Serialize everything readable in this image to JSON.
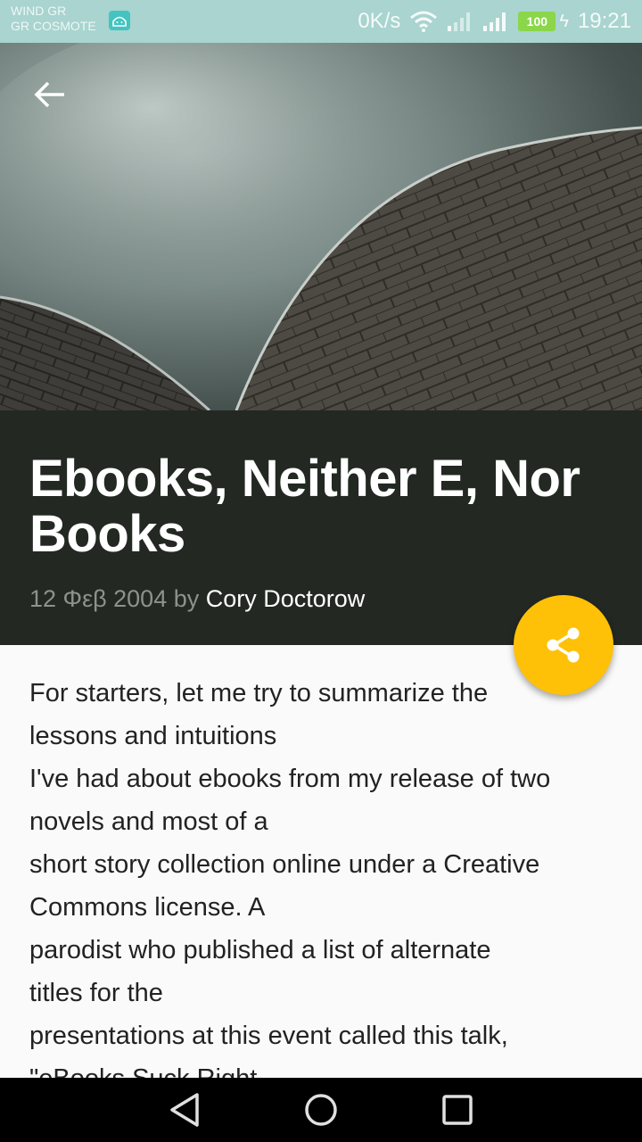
{
  "status_bar": {
    "carrier_line1": "WIND GR",
    "carrier_line2": "GR COSMOTE",
    "net_speed": "0K/s",
    "battery": "100",
    "time": "19:21"
  },
  "article": {
    "title": "Ebooks, Neither E, Nor Books",
    "date": "12 Φεβ 2004",
    "by": " by ",
    "author": "Cory Doctorow",
    "body_lines": [
      "For starters, let me try to summarize the",
      "lessons and intuitions",
      "I've had about ebooks from my release of two",
      "novels and most of a",
      "short story collection online under a Creative",
      "Commons license. A",
      "parodist who published a list of alternate",
      "titles for the",
      "presentations at this event called this talk,",
      "\"eBooks Suck Right"
    ]
  },
  "colors": {
    "status_bar": "#a9d4cf",
    "title_band": "#232823",
    "fab": "#ffc107",
    "background": "#fafafa"
  },
  "icons": {
    "back": "arrow-left-icon",
    "share": "share-icon",
    "nav_back": "triangle-back-icon",
    "nav_home": "circle-home-icon",
    "nav_recents": "square-recents-icon"
  }
}
